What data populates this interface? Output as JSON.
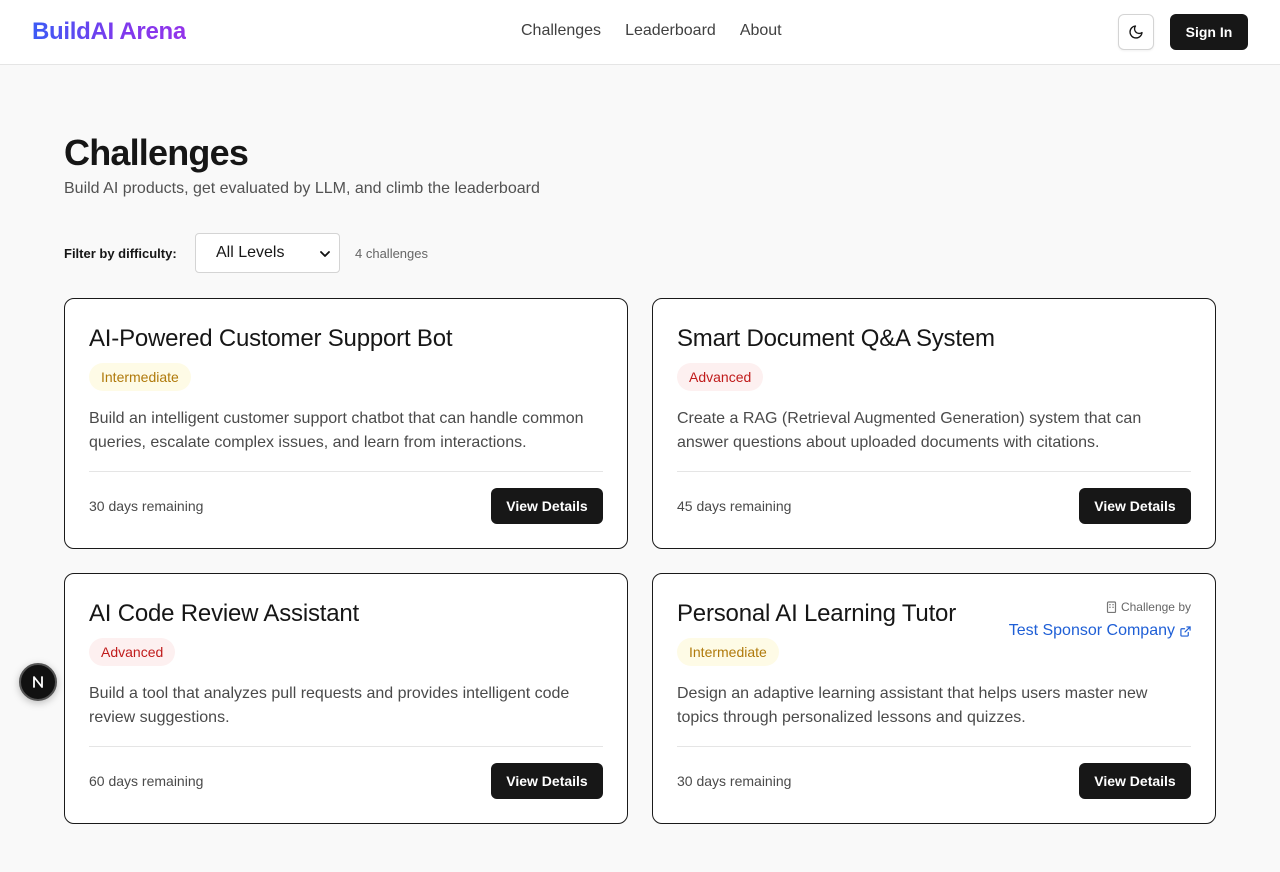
{
  "header": {
    "logo": "BuildAI Arena",
    "nav": [
      "Challenges",
      "Leaderboard",
      "About"
    ],
    "theme_icon": "moon-icon",
    "sign_in": "Sign In"
  },
  "page": {
    "title": "Challenges",
    "subtitle": "Build AI products, get evaluated by LLM, and climb the leaderboard"
  },
  "filter": {
    "label": "Filter by difficulty:",
    "selected": "All Levels",
    "count": "4 challenges"
  },
  "colors": {
    "primary_button": "#171717",
    "intermediate_text": "#b07a0b",
    "intermediate_bg": "#fefbe6",
    "advanced_text": "#c01b1b",
    "advanced_bg": "#fdf0f0",
    "sponsor_link": "#1f5fd6"
  },
  "challenges": [
    {
      "title": "AI-Powered Customer Support Bot",
      "difficulty": "Intermediate",
      "description": "Build an intelligent customer support chatbot that can handle common queries, escalate complex issues, and learn from interactions.",
      "remaining": "30 days remaining",
      "button": "View Details"
    },
    {
      "title": "Smart Document Q&A System",
      "difficulty": "Advanced",
      "description": "Create a RAG (Retrieval Augmented Generation) system that can answer questions about uploaded documents with citations.",
      "remaining": "45 days remaining",
      "button": "View Details"
    },
    {
      "title": "AI Code Review Assistant",
      "difficulty": "Advanced",
      "description": "Build a tool that analyzes pull requests and provides intelligent code review suggestions.",
      "remaining": "60 days remaining",
      "button": "View Details"
    },
    {
      "title": "Personal AI Learning Tutor",
      "difficulty": "Intermediate",
      "description": "Design an adaptive learning assistant that helps users master new topics through personalized lessons and quizzes.",
      "remaining": "30 days remaining",
      "button": "View Details",
      "sponsor": {
        "label": "Challenge by",
        "name": "Test Sponsor Company"
      }
    }
  ],
  "dev_badge": "N"
}
